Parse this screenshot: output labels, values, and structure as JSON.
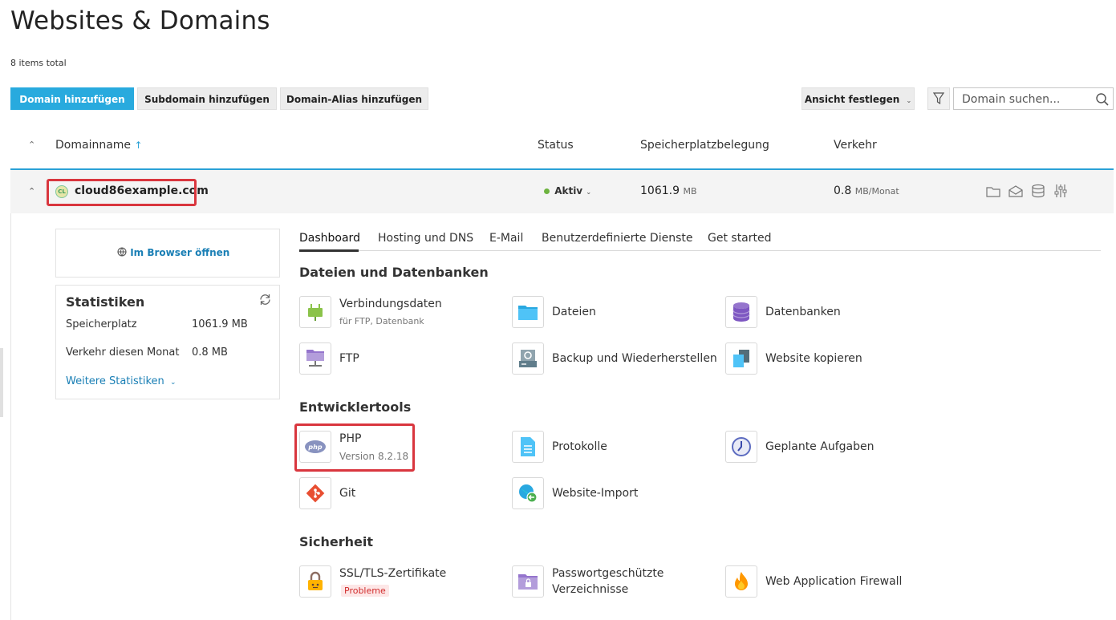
{
  "page": {
    "title": "Websites & Domains",
    "items_total": "8 items total"
  },
  "toolbar": {
    "add_domain": "Domain hinzufügen",
    "add_subdomain": "Subdomain hinzufügen",
    "add_alias": "Domain-Alias hinzufügen",
    "view": "Ansicht festlegen",
    "search_placeholder": "Domain suchen..."
  },
  "table": {
    "headers": {
      "domain": "Domainname",
      "status": "Status",
      "storage": "Speicherplatzbelegung",
      "traffic": "Verkehr"
    },
    "sort_arrow": "↑"
  },
  "domain": {
    "name": "cloud86example.com",
    "avatar": "CL",
    "status": "Aktiv",
    "storage_value": "1061.9",
    "storage_unit": "MB",
    "traffic_value": "0.8",
    "traffic_unit": "MB/Monat",
    "colors": {
      "status_dot": "#6db33f",
      "accent": "#28aade",
      "highlight": "#d9363e"
    }
  },
  "sidebar": {
    "open_browser": "Im Browser öffnen",
    "stats_title": "Statistiken",
    "storage_label": "Speicherplatz",
    "storage_value": "1061.9 MB",
    "traffic_label": "Verkehr diesen Monat",
    "traffic_value": "0.8 MB",
    "more": "Weitere Statistiken"
  },
  "tabs": [
    "Dashboard",
    "Hosting und DNS",
    "E-Mail",
    "Benutzerdefinierte Dienste",
    "Get started"
  ],
  "sections": {
    "files": {
      "title": "Dateien und Datenbanken",
      "items": [
        {
          "label": "Verbindungsdaten",
          "sub": "für FTP, Datenbank",
          "icon": "plug-icon"
        },
        {
          "label": "Dateien",
          "icon": "folder-icon"
        },
        {
          "label": "Datenbanken",
          "icon": "database-icon"
        },
        {
          "label": "FTP",
          "icon": "ftp-folder-icon"
        },
        {
          "label": "Backup und Wiederherstellen",
          "icon": "backup-icon"
        },
        {
          "label": "Website kopieren",
          "icon": "copy-icon"
        }
      ]
    },
    "dev": {
      "title": "Entwicklertools",
      "items": [
        {
          "label": "PHP",
          "sub": "Version 8.2.18",
          "icon": "php-icon"
        },
        {
          "label": "Protokolle",
          "icon": "log-icon"
        },
        {
          "label": "Geplante Aufgaben",
          "icon": "clock-icon"
        },
        {
          "label": "Git",
          "icon": "git-icon"
        },
        {
          "label": "Website-Import",
          "icon": "globe-import-icon"
        }
      ]
    },
    "security": {
      "title": "Sicherheit",
      "items": [
        {
          "label": "SSL/TLS-Zertifikate",
          "badge": "Probleme",
          "icon": "lock-icon"
        },
        {
          "label": "Passwortgeschützte Verzeichnisse",
          "label_line1": "Passwortgeschützte",
          "label_line2": "Verzeichnisse",
          "icon": "protected-folder-icon"
        },
        {
          "label": "Web Application Firewall",
          "icon": "firewall-icon"
        }
      ]
    }
  }
}
